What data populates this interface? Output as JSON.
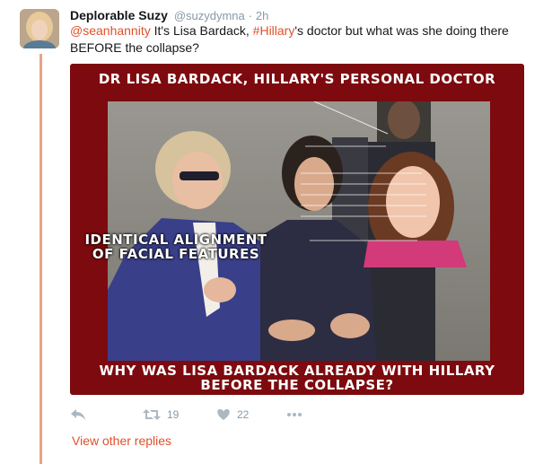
{
  "tweet": {
    "author_name": "Deplorable Suzy",
    "author_handle": "@suzydymna",
    "separator": "·",
    "timestamp": "2h",
    "text": {
      "mention": "@seanhannity",
      "part1": " It's Lisa Bardack, ",
      "hashtag": "#Hillary",
      "part2": "'s doctor but what was she doing there BEFORE the collapse?"
    }
  },
  "media": {
    "caption_top": "Dr Lisa Bardack, Hillary's Personal Doctor",
    "caption_middle": "Identical alignment of facial features",
    "caption_bottom": "Why was Lisa Bardack already with Hillary before the collapse?",
    "frame_color": "#7d0a0e"
  },
  "actions": {
    "reply_icon": "reply-icon",
    "retweet_icon": "retweet-icon",
    "retweet_count": "19",
    "like_icon": "heart-icon",
    "like_count": "22",
    "more_icon": "more-icon"
  },
  "thread": {
    "view_other_replies": "View other replies"
  },
  "colors": {
    "accent": "#e0502a",
    "thread_line": "#e8a485",
    "muted": "#8899a6"
  }
}
